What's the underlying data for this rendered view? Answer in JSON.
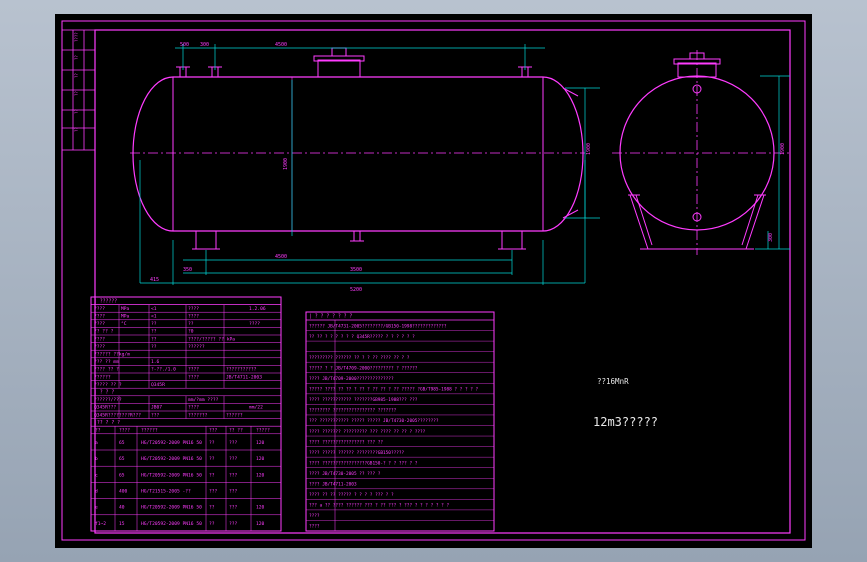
{
  "colors": {
    "background": "#000000",
    "frame": "#ff3cff",
    "dimension": "#00d9d9",
    "centerline": "#ff3cff",
    "text": "#ff3cff",
    "note": "#ffffff"
  },
  "note": {
    "material": "??16MnR",
    "title": "12m3?????"
  },
  "dims": {
    "top": [
      "500",
      "300",
      "4500"
    ],
    "bottom": [
      "4500",
      "3500",
      "5200"
    ],
    "left": [
      "415",
      "350"
    ],
    "side_height": "1900",
    "side_small": "300",
    "mid_height": "1900"
  },
  "design_table": {
    "header": "| ??????",
    "rows": [
      [
        "????",
        "MPa",
        "<1",
        "????",
        "",
        "1.2.06"
      ],
      [
        "????",
        "MPa",
        "<1",
        "????",
        "",
        ""
      ],
      [
        "????",
        "°C",
        "??",
        "??",
        "",
        "????"
      ],
      [
        "?? ?? ?",
        "",
        "??",
        "?0",
        "",
        ""
      ],
      [
        "????",
        "",
        "??",
        "????/????? ?? kPa",
        "",
        ""
      ],
      [
        "????",
        "",
        "??",
        "??????",
        "",
        ""
      ],
      [
        "?????? ??kg/m",
        "",
        "",
        "",
        "",
        ""
      ],
      [
        "??? ?? mm",
        "",
        "1.6",
        "",
        "",
        ""
      ],
      [
        "???? ?? ?",
        "",
        "?-??./1.0",
        "????",
        "???????????",
        ""
      ],
      [
        "??????",
        "",
        "",
        "????",
        "JB/T4711-2003",
        ""
      ],
      [
        "????? ?? ?",
        "",
        "Q345R",
        "",
        "",
        ""
      ]
    ],
    "sub_header": "| ? ? ?",
    "sub_rows": [
      [
        "??????/???",
        "",
        "",
        "mm/?mm ????",
        "",
        ""
      ],
      [
        "Q345R???",
        "",
        "JB07",
        "????",
        "",
        "mm/22"
      ],
      [
        "Q345R????????R???",
        "",
        "???",
        "???????",
        "??????",
        ""
      ]
    ],
    "nozzle_header": "|?? ? ? ?",
    "nozzle_cols": [
      "??",
      "????",
      "??????",
      "???",
      "?? ??",
      "?????"
    ],
    "nozzles": [
      [
        "a",
        "65",
        "HG/T20592-2009 PN16 50",
        "??",
        "???",
        "120"
      ],
      [
        "b",
        "65",
        "HG/T20592-2009 PN16 50",
        "??",
        "???",
        "120"
      ],
      [
        "c",
        "65",
        "HG/T20592-2009 PN16 50",
        "??",
        "???",
        "120"
      ],
      [
        "d",
        "400",
        "HG/T21515-2005 -??",
        "???",
        "???",
        ""
      ],
      [
        "e",
        "40",
        "HG/T20592-2009 PN16 50",
        "??",
        "???",
        "120"
      ],
      [
        "f1~2",
        "15",
        "HG/T20592-2009 PN16 50",
        "??",
        "???",
        "120"
      ]
    ]
  },
  "tech_table": {
    "header": "| ? ? ? ? ? ? ?",
    "rows": [
      "??????  JB/T4731-2005????????/GB150-1998?????????????",
      "?? ?? ? ? ? ? ? ? Q345R????? ? ? ? ? ? ?",
      "",
      "?????????  ?????? ?? ? ? ?? ???? ?? ?  ?",
      "????? ? ?  JB/T4709-2000????????? ? ??????",
      "????   JB/T4709-2000??????????????",
      "?????  ???? ?? ?? ? ?? ? ?? ?? ?  ?? ????? ?GB/T985-1988 ? ? ? ? ?",
      "????   ??????????? ???????GB985-1988???  ???",
      "???????? ???????????????? ???????",
      "??? ??????????? ????? ????? JB/T4730-2005????????",
      "????   ??????? ????????? ??? ???? ?? ?? ? ????",
      "????   ???????????????? ??? ??",
      "????   ????? ??????  ????????GB150?????",
      "????   ?????????????????GB150-? ? ?  ??? ? ?",
      "????   JB/T4730-2005 ?? ??? ?",
      "????   JB/T4711-2003",
      "????   ?? ?? ????? ? ? ? ? ??? ? ?",
      "???  a ?? ???? ?????? ??? ?  ?? ??? ? ??? ? ? ? ? ? ? ?",
      "????",
      "????"
    ]
  },
  "title_block_strip": [
    "????",
    "??",
    "??",
    "??",
    "??",
    "??"
  ]
}
